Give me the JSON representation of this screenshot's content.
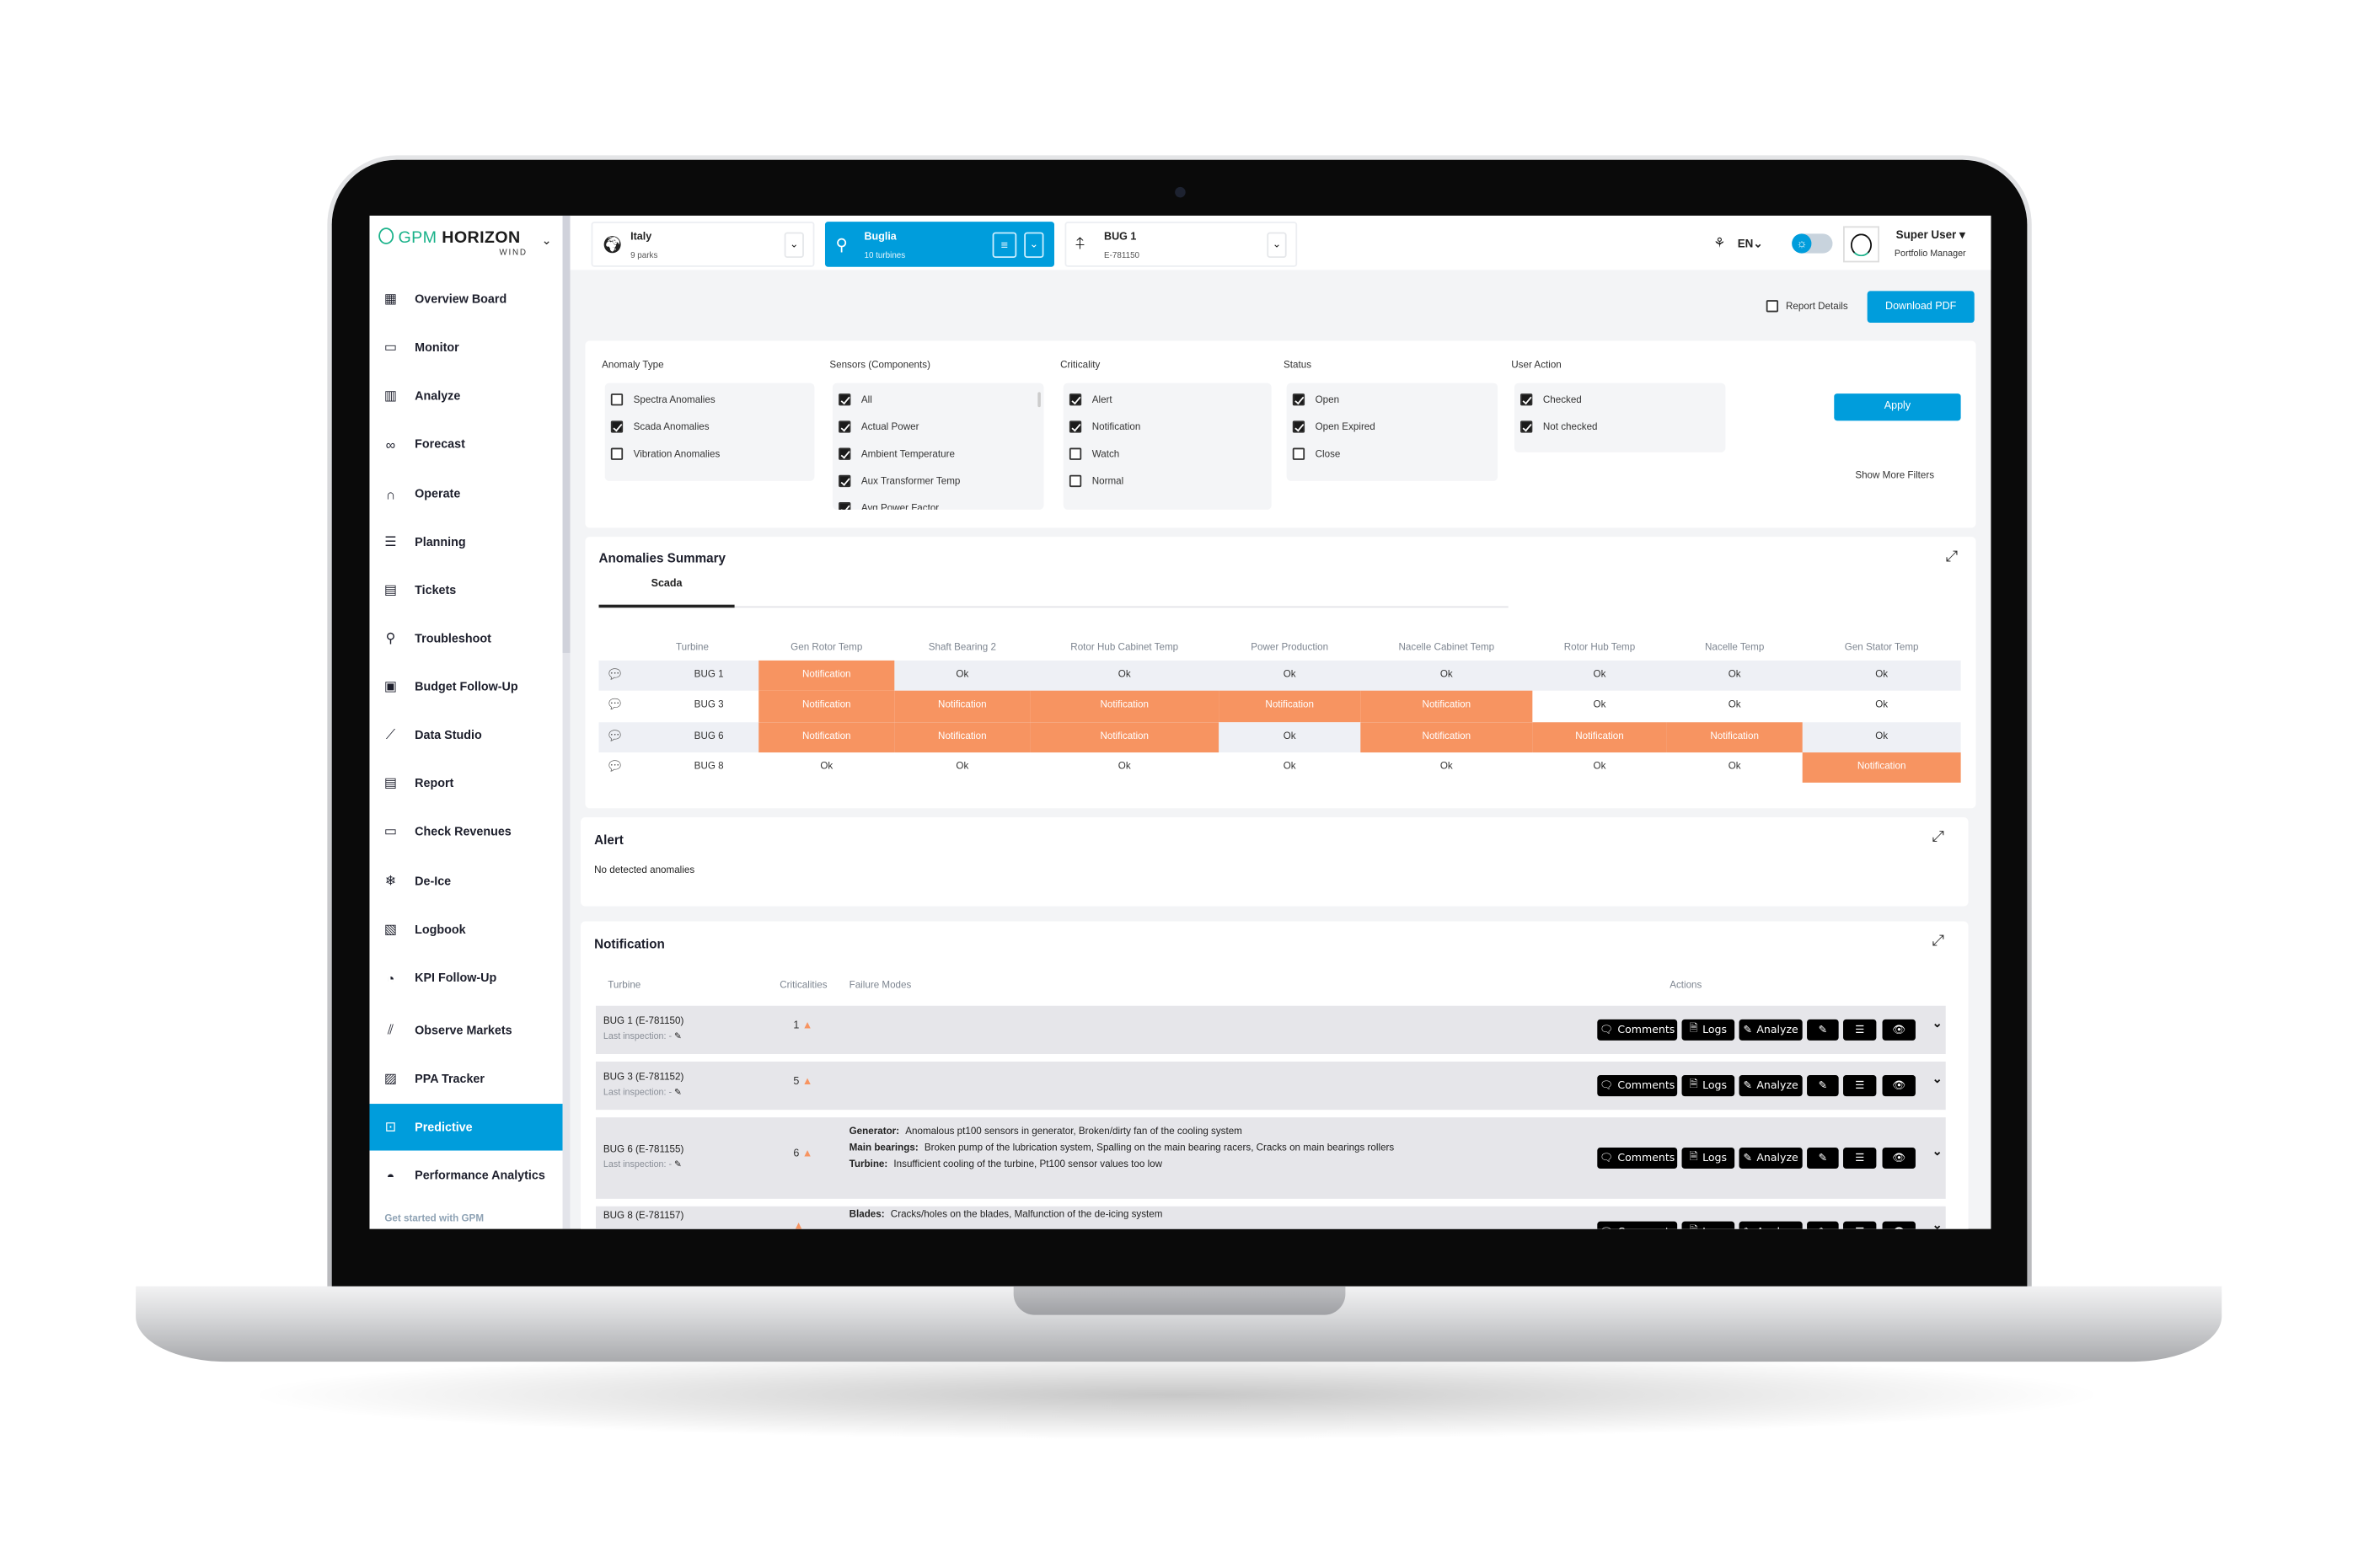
{
  "colors": {
    "accent": "#009ddc",
    "notification": "#f79461",
    "logo_green": "#1ab28a"
  },
  "app": {
    "logo_brand": "GPM",
    "logo_name": "HORIZON",
    "logo_sub": "WIND"
  },
  "sidebar": {
    "items": [
      {
        "label": "Overview Board",
        "icon": "grid-icon"
      },
      {
        "label": "Monitor",
        "icon": "monitor-icon"
      },
      {
        "label": "Analyze",
        "icon": "bar-chart-search-icon"
      },
      {
        "label": "Forecast",
        "icon": "binoculars-icon"
      },
      {
        "label": "Operate",
        "icon": "headset-icon"
      },
      {
        "label": "Planning",
        "icon": "planning-chart-icon"
      },
      {
        "label": "Tickets",
        "icon": "tickets-icon"
      },
      {
        "label": "Troubleshoot",
        "icon": "search-icon"
      },
      {
        "label": "Budget Follow-Up",
        "icon": "budget-icon"
      },
      {
        "label": "Data Studio",
        "icon": "line-chart-icon"
      },
      {
        "label": "Report",
        "icon": "clipboard-icon"
      },
      {
        "label": "Check Revenues",
        "icon": "wallet-icon"
      },
      {
        "label": "De-Ice",
        "icon": "snowflake-icon"
      },
      {
        "label": "Logbook",
        "icon": "logbook-icon"
      },
      {
        "label": "KPI Follow-Up",
        "icon": "pie-chart-icon"
      },
      {
        "label": "Observe Markets",
        "icon": "market-trend-icon"
      },
      {
        "label": "PPA Tracker",
        "icon": "document-check-icon"
      },
      {
        "label": "Predictive",
        "icon": "pulse-icon",
        "active": true
      },
      {
        "label": "Performance Analytics",
        "icon": "gauge-icon"
      }
    ],
    "footer": "Get started with GPM"
  },
  "topbar": {
    "country": {
      "title": "Italy",
      "sub": "9 parks"
    },
    "park": {
      "title": "Buglia",
      "sub": "10 turbines"
    },
    "turbine": {
      "title": "BUG 1",
      "sub": "E-781150"
    },
    "language": "EN",
    "user": {
      "name": "Super User",
      "role": "Portfolio Manager"
    }
  },
  "toolbar": {
    "report_details": "Report Details",
    "report_details_checked": false,
    "download_pdf": "Download PDF"
  },
  "filters": {
    "groups": [
      {
        "label": "Anomaly Type",
        "items": [
          {
            "label": "Spectra Anomalies",
            "checked": false
          },
          {
            "label": "Scada Anomalies",
            "checked": true
          },
          {
            "label": "Vibration Anomalies",
            "checked": false
          }
        ]
      },
      {
        "label": "Sensors (Components)",
        "items": [
          {
            "label": "All",
            "checked": true
          },
          {
            "label": "Actual Power",
            "checked": true
          },
          {
            "label": "Ambient Temperature",
            "checked": true
          },
          {
            "label": "Aux Transformer Temp",
            "checked": true
          },
          {
            "label": "Avg Power Factor",
            "checked": true
          }
        ]
      },
      {
        "label": "Criticality",
        "items": [
          {
            "label": "Alert",
            "checked": true
          },
          {
            "label": "Notification",
            "checked": true
          },
          {
            "label": "Watch",
            "checked": false
          },
          {
            "label": "Normal",
            "checked": false
          }
        ]
      },
      {
        "label": "Status",
        "items": [
          {
            "label": "Open",
            "checked": true
          },
          {
            "label": "Open Expired",
            "checked": true
          },
          {
            "label": "Close",
            "checked": false
          }
        ]
      },
      {
        "label": "User Action",
        "items": [
          {
            "label": "Checked",
            "checked": true
          },
          {
            "label": "Not checked",
            "checked": true
          }
        ]
      }
    ],
    "apply": "Apply",
    "show_more": "Show More Filters"
  },
  "summary": {
    "title": "Anomalies Summary",
    "tabs": [
      "Scada"
    ],
    "columns": [
      "Turbine",
      "Gen Rotor Temp",
      "Shaft Bearing 2",
      "Rotor Hub Cabinet Temp",
      "Power Production",
      "Nacelle Cabinet Temp",
      "Rotor Hub Temp",
      "Nacelle Temp",
      "Gen Stator Temp"
    ],
    "rows": [
      {
        "turbine": "BUG 1",
        "values": [
          "Notification",
          "Ok",
          "Ok",
          "Ok",
          "Ok",
          "Ok",
          "Ok",
          "Ok"
        ]
      },
      {
        "turbine": "BUG 3",
        "values": [
          "Notification",
          "Notification",
          "Notification",
          "Notification",
          "Notification",
          "Ok",
          "Ok",
          "Ok"
        ]
      },
      {
        "turbine": "BUG 6",
        "values": [
          "Notification",
          "Notification",
          "Notification",
          "Ok",
          "Notification",
          "Notification",
          "Notification",
          "Ok"
        ]
      },
      {
        "turbine": "BUG 8",
        "values": [
          "Ok",
          "Ok",
          "Ok",
          "Ok",
          "Ok",
          "Ok",
          "Ok",
          "Notification"
        ]
      }
    ]
  },
  "alert": {
    "title": "Alert",
    "empty": "No detected anomalies"
  },
  "notification": {
    "title": "Notification",
    "columns": {
      "turbine": "Turbine",
      "criticalities": "Criticalities",
      "failure_modes": "Failure Modes",
      "actions": "Actions"
    },
    "actions": {
      "comments": "Comments",
      "logs": "Logs",
      "analyze": "Analyze"
    },
    "rows": [
      {
        "turbine": "BUG 1 (E-781150)",
        "inspection": "Last inspection: -",
        "criticalities": "1",
        "failure_modes": []
      },
      {
        "turbine": "BUG 3 (E-781152)",
        "inspection": "Last inspection: -",
        "criticalities": "5",
        "failure_modes": []
      },
      {
        "turbine": "BUG 6 (E-781155)",
        "inspection": "Last inspection: -",
        "criticalities": "6",
        "failure_modes": [
          {
            "component": "Generator:",
            "modes": "Anomalous pt100 sensors in generator, Broken/dirty fan of the cooling system"
          },
          {
            "component": "Main bearings:",
            "modes": "Broken pump of the lubrication system, Spalling on the main bearing racers, Cracks on main bearings rollers"
          },
          {
            "component": "Turbine:",
            "modes": "Insufficient cooling of the turbine, Pt100 sensor values too low"
          }
        ]
      },
      {
        "turbine": "BUG 8 (E-781157)",
        "inspection": "",
        "criticalities": "",
        "failure_modes": [
          {
            "component": "Blades:",
            "modes": "Cracks/holes on the blades, Malfunction of the de-icing system"
          }
        ]
      }
    ]
  }
}
